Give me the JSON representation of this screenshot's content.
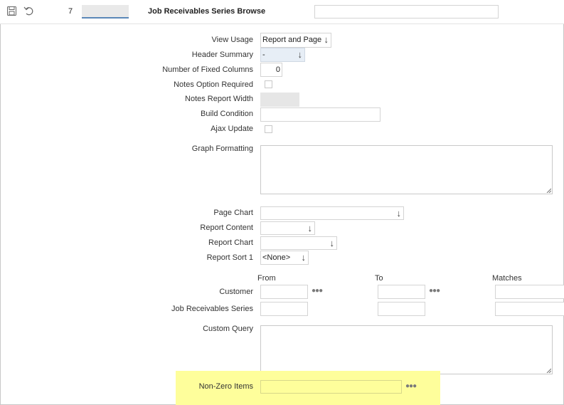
{
  "toolbar": {
    "save_icon": "floppy-disk-icon",
    "undo_icon": "undo-arrow-icon",
    "sequence": "7",
    "sequence_tab_value": "",
    "title": "Job Receivables Series Browse",
    "title_field_value": ""
  },
  "form": {
    "view_usage": {
      "label": "View Usage",
      "value": "Report and Page"
    },
    "header_summary": {
      "label": "Header Summary",
      "value": "-"
    },
    "fixed_columns": {
      "label": "Number of Fixed Columns",
      "value": "0"
    },
    "notes_option_required": {
      "label": "Notes Option Required",
      "checked": false
    },
    "notes_report_width": {
      "label": "Notes Report Width",
      "value": ""
    },
    "build_condition": {
      "label": "Build Condition",
      "value": ""
    },
    "ajax_update": {
      "label": "Ajax Update",
      "checked": false
    },
    "graph_formatting": {
      "label": "Graph Formatting",
      "value": ""
    },
    "page_chart": {
      "label": "Page Chart",
      "value": ""
    },
    "report_content": {
      "label": "Report Content",
      "value": ""
    },
    "report_chart": {
      "label": "Report Chart",
      "value": ""
    },
    "report_sort_1": {
      "label": "Report Sort 1",
      "value": "<None>"
    }
  },
  "filters": {
    "col_from": "From",
    "col_to": "To",
    "col_matches": "Matches",
    "rows": [
      {
        "label": "Customer",
        "from": "",
        "to": "",
        "matches": "",
        "has_lookup": true
      },
      {
        "label": "Job Receivables Series",
        "from": "",
        "to": "",
        "matches": "",
        "has_lookup": false
      }
    ]
  },
  "custom_query": {
    "label": "Custom Query",
    "value": ""
  },
  "non_zero_items": {
    "label": "Non-Zero Items",
    "value": "",
    "highlight_color": "#fefe9b"
  },
  "colors": {
    "border": "#d4d4d4",
    "readonly": "#e6e6e6",
    "highlight": "#fefe9b"
  }
}
